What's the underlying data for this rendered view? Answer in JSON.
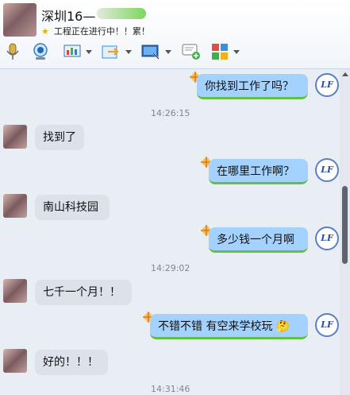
{
  "header": {
    "contact_name": "深圳16—",
    "status_text": "工程正在进行中！！累！",
    "status_star": "★"
  },
  "toolbar": {
    "items": [
      {
        "icon": "microphone-icon"
      },
      {
        "icon": "webcam-icon"
      },
      {
        "icon": "screen-share-icon"
      },
      {
        "icon": "file-transfer-icon"
      },
      {
        "icon": "remote-desktop-icon"
      },
      {
        "icon": "sms-icon"
      },
      {
        "icon": "apps-icon"
      }
    ]
  },
  "messages": [
    {
      "dir": "out",
      "text": "你找到工作了吗？"
    },
    {
      "time": "14:26:15"
    },
    {
      "dir": "in",
      "text": "找到了"
    },
    {
      "dir": "out",
      "text": "在哪里工作啊？"
    },
    {
      "dir": "in",
      "text": "南山科技园"
    },
    {
      "dir": "out",
      "text": "多少钱一个月啊"
    },
    {
      "time": "14:29:02"
    },
    {
      "dir": "in",
      "text": "七千一个月！！"
    },
    {
      "dir": "out",
      "text": "不错不错 有空来学校玩",
      "emoji": "🤔"
    },
    {
      "dir": "in",
      "text": "好的！！！"
    },
    {
      "time": "14:31:46"
    }
  ],
  "self_avatar_text": "LF",
  "colors": {
    "outgoing_bubble": "#a4d2ff",
    "outgoing_underline": "#63c043",
    "incoming_bubble": "#dde2ea",
    "background": "#e9eef5"
  }
}
